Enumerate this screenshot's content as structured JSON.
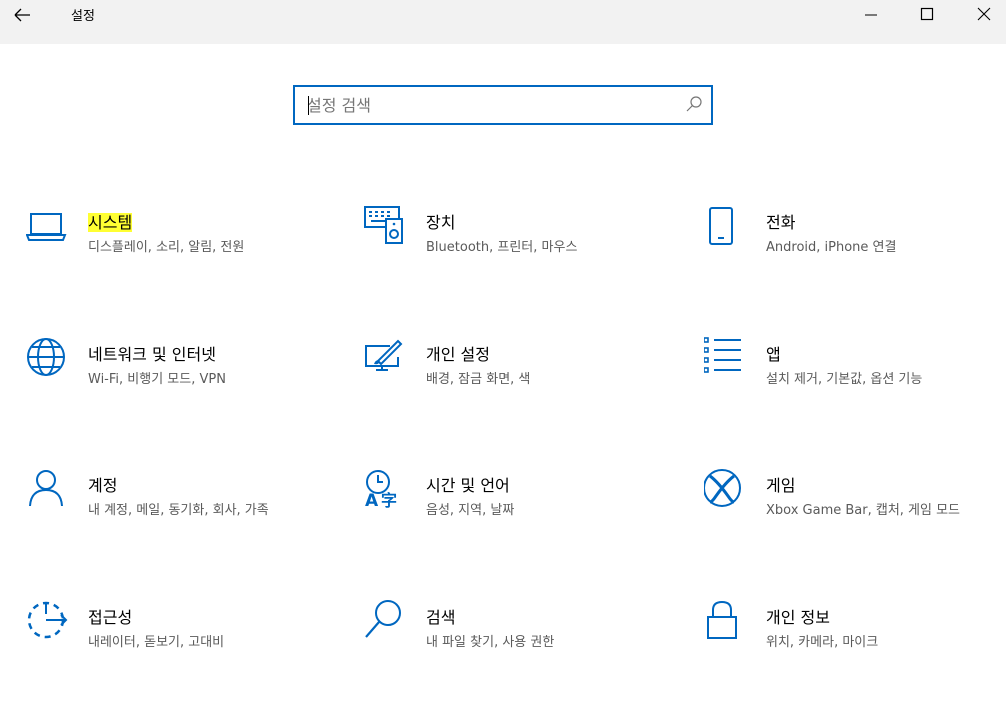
{
  "window": {
    "title": "설정",
    "back_icon": "arrow-left-icon",
    "controls": [
      "minimize-icon",
      "maximize-icon",
      "close-icon"
    ]
  },
  "search": {
    "placeholder": "설정 검색",
    "icon": "search-icon"
  },
  "accent_color": "#0067c0",
  "highlight_color": "#ffff33",
  "tiles": [
    {
      "name": "시스템",
      "desc": "디스플레이, 소리, 알림, 전원",
      "icon": "laptop-icon",
      "highlighted": true
    },
    {
      "name": "장치",
      "desc": "Bluetooth, 프린터, 마우스",
      "icon": "devices-icon"
    },
    {
      "name": "전화",
      "desc": "Android, iPhone 연결",
      "icon": "phone-icon"
    },
    {
      "name": "네트워크 및 인터넷",
      "desc": "Wi-Fi, 비행기 모드, VPN",
      "icon": "globe-icon"
    },
    {
      "name": "개인 설정",
      "desc": "배경, 잠금 화면, 색",
      "icon": "personalization-icon"
    },
    {
      "name": "앱",
      "desc": "설치 제거, 기본값, 옵션 기능",
      "icon": "apps-list-icon"
    },
    {
      "name": "계정",
      "desc": "내 계정, 메일, 동기화, 회사, 가족",
      "icon": "person-icon"
    },
    {
      "name": "시간 및 언어",
      "desc": "음성, 지역, 날짜",
      "icon": "time-language-icon"
    },
    {
      "name": "게임",
      "desc": "Xbox Game Bar, 캡처, 게임 모드",
      "icon": "xbox-icon"
    },
    {
      "name": "접근성",
      "desc": "내레이터, 돋보기, 고대비",
      "icon": "accessibility-icon"
    },
    {
      "name": "검색",
      "desc": "내 파일 찾기, 사용 권한",
      "icon": "search-tile-icon"
    },
    {
      "name": "개인 정보",
      "desc": "위치, 카메라, 마이크",
      "icon": "lock-icon"
    }
  ]
}
